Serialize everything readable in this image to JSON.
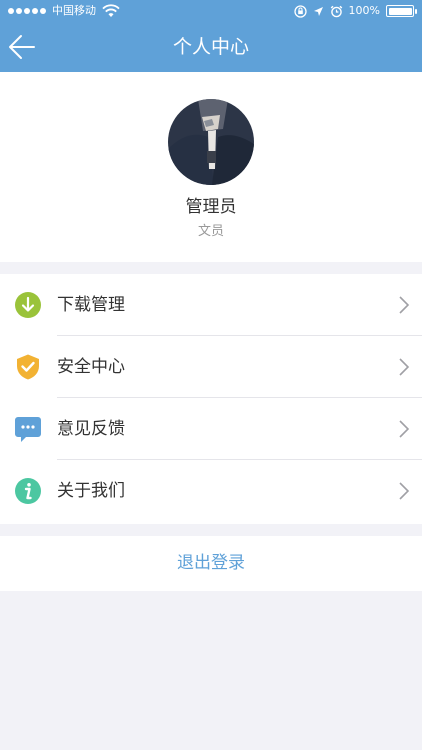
{
  "status_bar": {
    "carrier": "中国移动",
    "battery": "100%",
    "battery_level": 1.0,
    "icons": [
      "signal-dots-icon",
      "wifi-icon",
      "orientation-lock-icon",
      "location-icon",
      "alarm-icon",
      "battery-icon"
    ]
  },
  "nav": {
    "title": "个人中心",
    "back_icon": "arrow-left-icon"
  },
  "profile": {
    "name": "管理员",
    "role": "文员"
  },
  "menu": {
    "items": [
      {
        "label": "下载管理",
        "icon": "download-icon",
        "color": "#9ac33a"
      },
      {
        "label": "安全中心",
        "icon": "shield-check-icon",
        "color": "#f2b233"
      },
      {
        "label": "意见反馈",
        "icon": "chat-bubble-icon",
        "color": "#5fa1d8"
      },
      {
        "label": "关于我们",
        "icon": "info-icon",
        "color": "#4cc7a1"
      }
    ]
  },
  "logout": {
    "label": "退出登录"
  },
  "colors": {
    "primary": "#5fa1d8",
    "background": "#f2f2f7",
    "text": "#333333",
    "muted": "#999999"
  }
}
